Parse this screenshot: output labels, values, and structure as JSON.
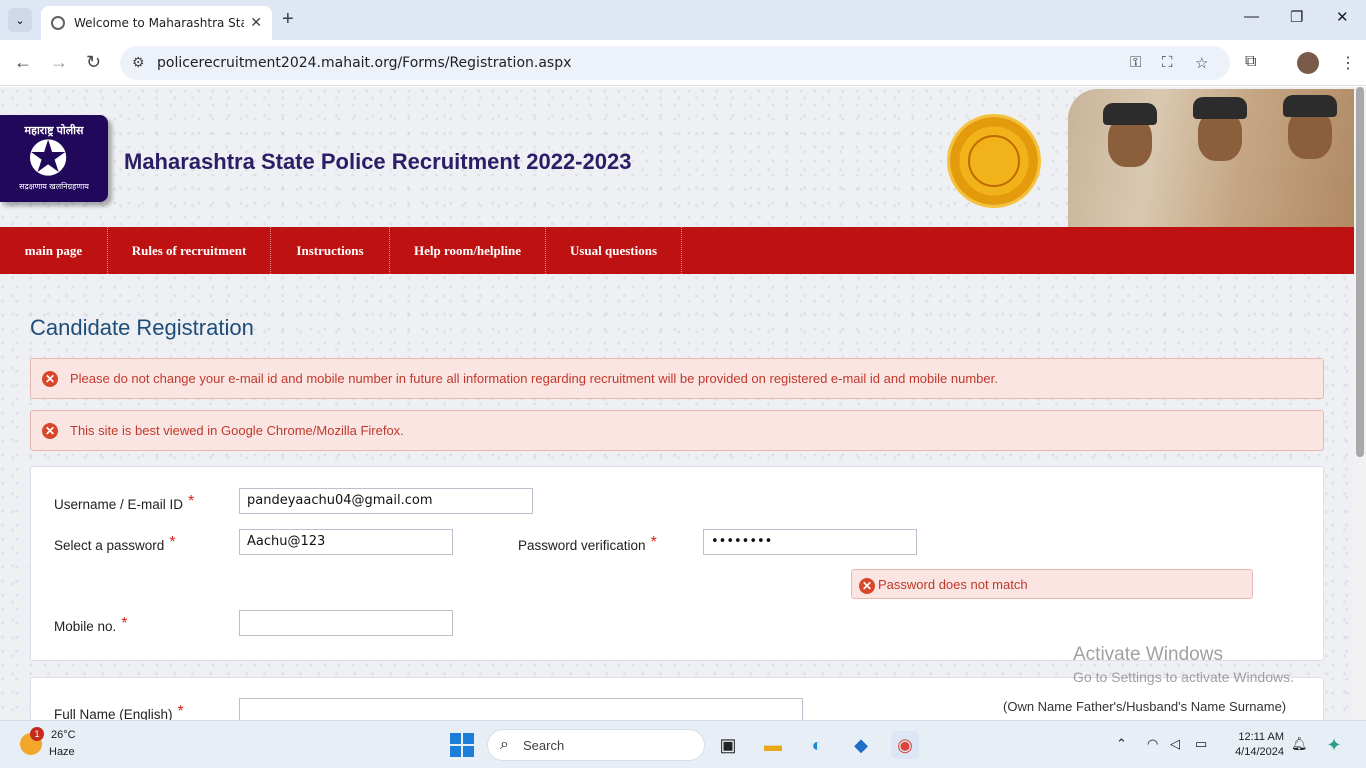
{
  "browser": {
    "tab_title": "Welcome to Maharashtra State",
    "url": "policerecruitment2024.mahait.org/Forms/Registration.aspx"
  },
  "site": {
    "logo_top": "महाराष्ट्र पोलीस",
    "logo_bottom": "सद्रक्षणाय खलनिग्रहणाय",
    "title": "Maharashtra State Police Recruitment 2022-2023"
  },
  "nav": {
    "items": [
      "main page",
      "Rules of recruitment",
      "Instructions",
      "Help room/helpline",
      "Usual questions"
    ]
  },
  "page": {
    "heading": "Candidate Registration",
    "alerts": [
      "Please do not change your e-mail id and mobile number in future all information regarding recruitment will be provided on registered e-mail id and mobile number.",
      "This site is best viewed in Google Chrome/Mozilla Firefox."
    ]
  },
  "form": {
    "username_label": "Username / E-mail ID",
    "username_value": "pandeyaachu04@gmail.com",
    "password_label": "Select a password",
    "password_value": "Aachu@123",
    "verify_label": "Password verification",
    "verify_value": "••••••••",
    "mismatch_error": "Password does not match",
    "mobile_label": "Mobile no.",
    "mobile_value": "",
    "fullname_label": "Full Name (English)",
    "fullname_value": "",
    "fullname_hint": "(Own Name Father's/Husband's Name Surname)",
    "required_mark": "*"
  },
  "watermark": {
    "line1": "Activate Windows",
    "line2": "Go to Settings to activate Windows."
  },
  "taskbar": {
    "badge": "1",
    "temperature": "26°C",
    "condition": "Haze",
    "search_placeholder": "Search",
    "time": "12:11 AM",
    "date": "4/14/2024"
  }
}
